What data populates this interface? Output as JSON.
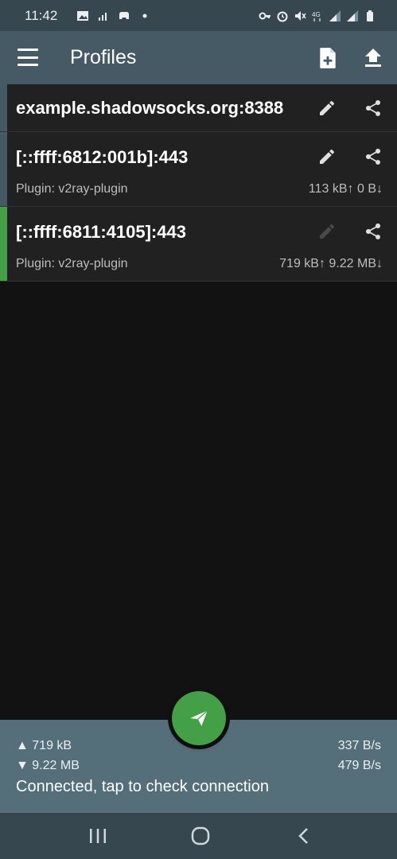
{
  "status_bar": {
    "time": "11:42",
    "left_icons": [
      "image-icon",
      "signal-off-icon",
      "game-controller-icon",
      "notification-dot-icon"
    ],
    "right_icons": [
      "vpn-key-icon",
      "alarm-icon",
      "mute-icon",
      "4g-icon",
      "signal-icon",
      "signal-icon",
      "battery-icon"
    ]
  },
  "app_bar": {
    "title": "Profiles",
    "actions": [
      "new-file-icon",
      "upload-icon"
    ]
  },
  "profiles": [
    {
      "name": "example.shadowsocks.org:8388",
      "plugin": "",
      "traffic": "",
      "active": false,
      "edit_enabled": true
    },
    {
      "name": "[::ffff:6812:001b]:443",
      "plugin": "Plugin: v2ray-plugin",
      "traffic": "113 kB↑ 0 B↓",
      "active": false,
      "edit_enabled": true
    },
    {
      "name": "[::ffff:6811:4105]:443",
      "plugin": "Plugin: v2ray-plugin",
      "traffic": "719 kB↑ 9.22 MB↓",
      "active": true,
      "edit_enabled": false
    }
  ],
  "stats": {
    "tx_total": "▲ 719 kB",
    "rx_total": "▼ 9.22 MB",
    "tx_rate": "337 B/s",
    "rx_rate": "479 B/s",
    "status_text": "Connected, tap to check connection"
  },
  "colors": {
    "accent": "#43a047",
    "app_bar": "#455a64",
    "status_bar": "#37474f",
    "stats_bar": "#546e7a",
    "background": "#121212"
  }
}
